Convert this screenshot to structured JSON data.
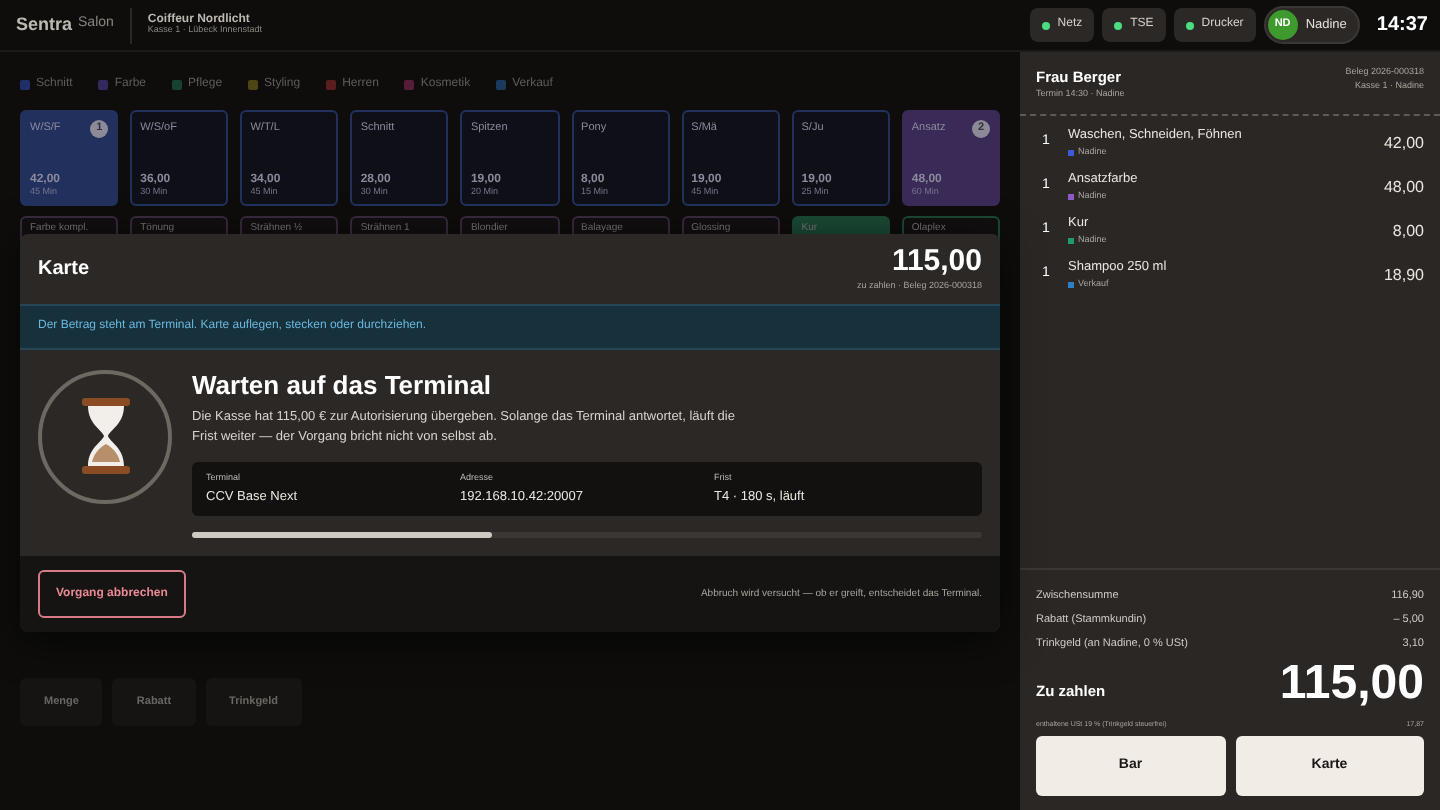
{
  "header": {
    "brand": "Sentra",
    "brand_suffix": "Salon",
    "shop": "Coiffeur Nordlicht",
    "register": "Kasse 1 · Lübeck Innenstadt",
    "status": [
      {
        "label": "Netz",
        "color": "#4ade80"
      },
      {
        "label": "TSE",
        "color": "#4ade80"
      },
      {
        "label": "Drucker",
        "color": "#4ade80"
      }
    ],
    "user": {
      "initials": "ND",
      "name": "Nadine"
    },
    "time": "14:37"
  },
  "categories": [
    {
      "label": "Schnitt",
      "color": "#1f2f6a"
    },
    {
      "label": "Farbe",
      "color": "#35285e"
    },
    {
      "label": "Pflege",
      "color": "#16432f"
    },
    {
      "label": "Styling",
      "color": "#4f4513"
    },
    {
      "label": "Herren",
      "color": "#5a1e1e"
    },
    {
      "label": "Kosmetik",
      "color": "#561d36"
    },
    {
      "label": "Verkauf",
      "color": "#1a3a5e"
    }
  ],
  "tiles": [
    {
      "name": "W/S/F",
      "price": "42,00",
      "minutes": "45 Min",
      "count": "1",
      "selected": true,
      "color": "#22305e"
    },
    {
      "name": "W/S/oF",
      "price": "36,00",
      "minutes": "30 Min",
      "selected": false,
      "color": "#22305e"
    },
    {
      "name": "W/T/L",
      "price": "34,00",
      "minutes": "45 Min",
      "selected": false,
      "color": "#22305e"
    },
    {
      "name": "Schnitt",
      "price": "28,00",
      "minutes": "30 Min",
      "selected": false,
      "color": "#22305e"
    },
    {
      "name": "Spitzen",
      "price": "19,00",
      "minutes": "20 Min",
      "selected": false,
      "color": "#22305e"
    },
    {
      "name": "Pony",
      "price": "8,00",
      "minutes": "15 Min",
      "selected": false,
      "color": "#22305e"
    },
    {
      "name": "S/Mä",
      "price": "19,00",
      "minutes": "45 Min",
      "selected": false,
      "color": "#22305e"
    },
    {
      "name": "S/Ju",
      "price": "19,00",
      "minutes": "25 Min",
      "selected": false,
      "color": "#22305e"
    },
    {
      "name": "Ansatz",
      "price": "48,00",
      "minutes": "60 Min",
      "count": "2",
      "selected": true,
      "color": "#3a2a58"
    }
  ],
  "tiles_row_2": [
    {
      "name": "Farbe kompl.",
      "selected": false,
      "color": "#3a2a40"
    },
    {
      "name": "Tönung",
      "selected": false,
      "color": "#3a2a40"
    },
    {
      "name": "Strähnen ½",
      "selected": false,
      "color": "#3a2a40"
    },
    {
      "name": "Strähnen 1",
      "selected": false,
      "color": "#3a2a40"
    },
    {
      "name": "Blondier",
      "selected": false,
      "color": "#3a2a40"
    },
    {
      "name": "Balayage",
      "selected": false,
      "color": "#3a2a40"
    },
    {
      "name": "Glossing",
      "selected": false,
      "color": "#3a2a40"
    },
    {
      "name": "Kur",
      "selected": true,
      "color": "#1a4a34"
    },
    {
      "name": "Olaplex",
      "selected": false,
      "color": "#1a4a34"
    }
  ],
  "actions": [
    "Menge",
    "Rabatt",
    "Trinkgeld"
  ],
  "dialog": {
    "title": "Karte",
    "amount": "115,00",
    "amount_caption": "zu zahlen · Beleg 2026-000318",
    "notice": "Der Betrag steht am Terminal. Karte auflegen, stecken oder durchziehen.",
    "heading": "Warten auf das Terminal",
    "text": "Die Kasse hat 115,00 € zur Autorisierung übergeben. Solange das Terminal antwortet, läuft die Frist weiter — der Vorgang bricht nicht von selbst ab.",
    "details": [
      {
        "label": "Terminal",
        "value": "CCV Base Next"
      },
      {
        "label": "Adresse",
        "value": "192.168.10.42:20007"
      },
      {
        "label": "Frist",
        "value": "T4 · 180 s, läuft"
      }
    ],
    "progress": {
      "level": 0.38
    },
    "cancel": "Vorgang abbrechen",
    "footnote": "Abbruch wird versucht — ob er greift, entscheidet das Terminal."
  },
  "receipt": {
    "customer": "Frau Berger",
    "appointment": "Termin 14:30 · Nadine",
    "receipt_no": "Beleg 2026-000318",
    "register": "Kasse 1 · Nadine",
    "items": [
      {
        "qty": "1",
        "name": "Waschen, Schneiden, Föhnen",
        "staff": "Nadine",
        "color": "#3b5bdb",
        "price": "42,00"
      },
      {
        "qty": "1",
        "name": "Ansatzfarbe",
        "staff": "Nadine",
        "color": "#8b5cc6",
        "price": "48,00"
      },
      {
        "qty": "1",
        "name": "Kur",
        "staff": "Nadine",
        "color": "#1f9a6b",
        "price": "8,00"
      },
      {
        "qty": "1",
        "name": "Shampoo 250 ml",
        "staff": "Verkauf",
        "color": "#2f7fc5",
        "price": "18,90"
      }
    ],
    "totals": [
      {
        "label": "Zwischensumme",
        "value": "116,90"
      },
      {
        "label": "Rabatt (Stammkundin)",
        "value": "– 5,00"
      },
      {
        "label": "Trinkgeld (an Nadine, 0 % USt)",
        "value": "3,10"
      }
    ],
    "due_label": "Zu zahlen",
    "due": "115,00",
    "tax_note": "enthaltene USt 19 % (Trinkgeld steuerfrei)",
    "tax": "17,87",
    "buttons": [
      "Bar",
      "Karte"
    ]
  }
}
